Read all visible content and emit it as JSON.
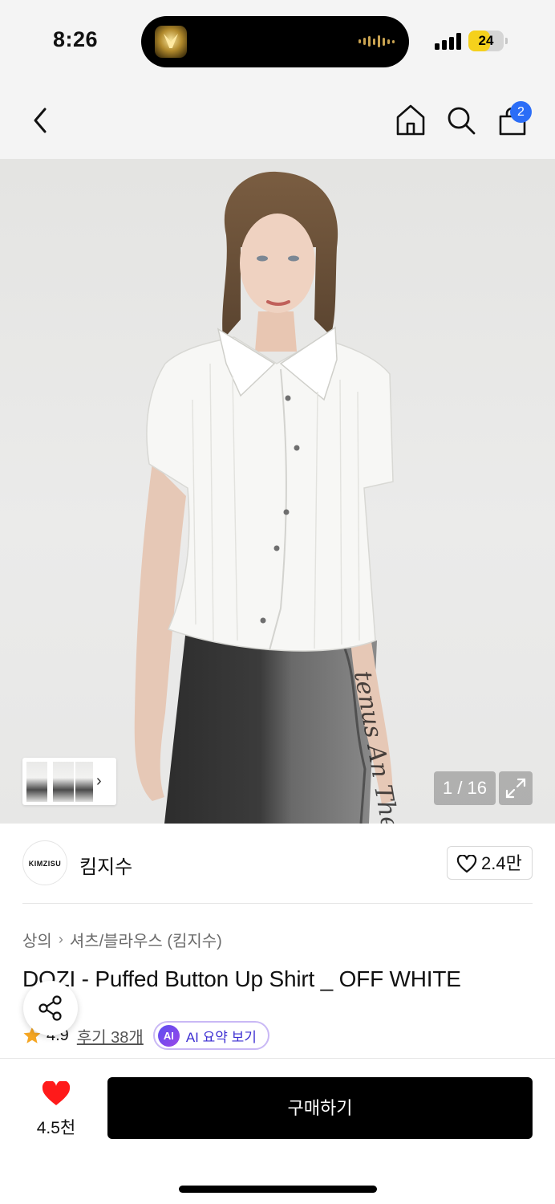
{
  "status_bar": {
    "time": "8:26",
    "battery": "24",
    "battery_level": 0.24,
    "accent": "#f5d11c"
  },
  "nav": {
    "back_icon": "chevron-left-icon",
    "home_icon": "home-icon",
    "search_icon": "search-icon",
    "cart_icon": "shopping-bag-icon",
    "cart_count": "2",
    "badge_color": "#2b6df7"
  },
  "gallery": {
    "counter": "1 / 16",
    "expand_icon": "expand-icon",
    "thumb_next_icon": "chevron-right-icon"
  },
  "brand": {
    "logo_text": "KIMZISU",
    "name": "킴지수",
    "follow_icon": "heart-outline-icon",
    "follow_count": "2.4만"
  },
  "product": {
    "breadcrumb": [
      "상의",
      "셔츠/블라우스 (킴지수)"
    ],
    "title": "DOZI - Puffed Button Up Shirt _ OFF WHITE",
    "rating": "4.9",
    "review_link": "후기 38개",
    "ai_badge": "AI",
    "ai_label": "AI 요약 보기"
  },
  "share": {
    "icon": "share-icon"
  },
  "bottom": {
    "like_icon": "heart-filled-icon",
    "like_count": "4.5천",
    "buy_label": "구매하기",
    "like_color": "#ff1a1a"
  }
}
